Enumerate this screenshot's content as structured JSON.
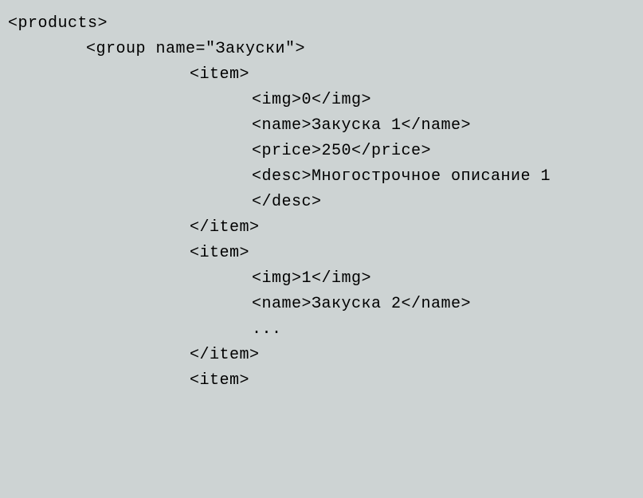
{
  "code": {
    "l1": "<products>",
    "l2": "<group name=\"Закуски\">",
    "l3": "<item>",
    "l4": "<img>0</img>",
    "l5": "<name>Закуска 1</name>",
    "l6": "<price>250</price>",
    "l7": "<desc>Многострочное описание 1",
    "l8": "</desc>",
    "l9": "</item>",
    "l10": "<item>",
    "l11": "<img>1</img>",
    "l12": "<name>Закуска 2</name>",
    "l13": "...",
    "l14": "</item>",
    "l15": "<item>"
  }
}
